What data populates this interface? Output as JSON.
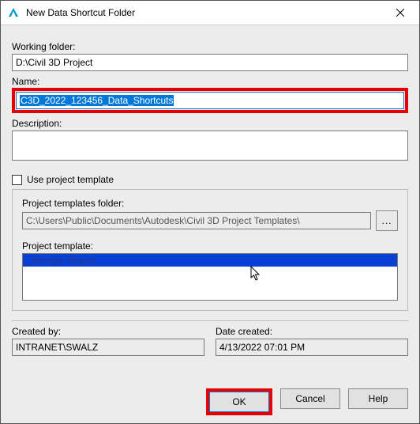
{
  "title": "New Data Shortcut Folder",
  "labels": {
    "working_folder": "Working folder:",
    "name": "Name:",
    "description": "Description:",
    "use_template": "Use project template",
    "templates_folder": "Project templates folder:",
    "project_template": "Project template:",
    "created_by": "Created by:",
    "date_created": "Date created:"
  },
  "values": {
    "working_folder": "D:\\Civil 3D Project",
    "name": "C3D_2022_123456_Data_Shortcuts",
    "description": "",
    "templates_folder": "C:\\Users\\Public\\Documents\\Autodesk\\Civil 3D Project Templates\\",
    "template_selected": "_Sample Project",
    "created_by": "INTRANET\\SWALZ",
    "date_created": "4/13/2022 07:01 PM"
  },
  "buttons": {
    "ok": "OK",
    "cancel": "Cancel",
    "help": "Help",
    "browse": "..."
  },
  "use_template_checked": false
}
